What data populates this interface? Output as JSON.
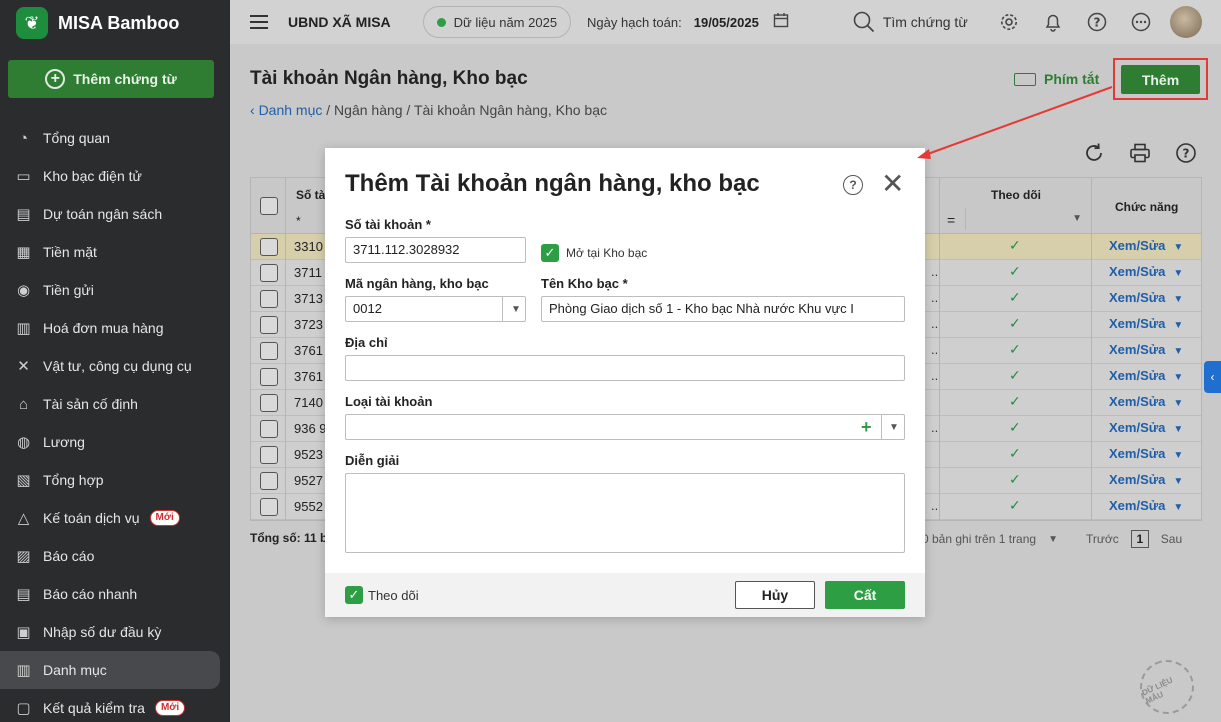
{
  "brand": {
    "name": "MISA Bamboo"
  },
  "new_voucher": {
    "label": "Thêm chứng từ"
  },
  "nav": [
    {
      "label": "Tổng quan",
      "icon": "pie-chart-icon"
    },
    {
      "label": "Kho bạc điện tử",
      "icon": "monitor-icon"
    },
    {
      "label": "Dự toán ngân sách",
      "icon": "budget-icon"
    },
    {
      "label": "Tiền mặt",
      "icon": "cash-icon"
    },
    {
      "label": "Tiền gửi",
      "icon": "deposit-icon"
    },
    {
      "label": "Hoá đơn mua hàng",
      "icon": "invoice-icon"
    },
    {
      "label": "Vật tư, công cụ dụng cụ",
      "icon": "tools-icon"
    },
    {
      "label": "Tài sản cố định",
      "icon": "building-icon"
    },
    {
      "label": "Lương",
      "icon": "salary-icon"
    },
    {
      "label": "Tổng hợp",
      "icon": "summary-icon"
    },
    {
      "label": "Kế toán dịch vụ",
      "icon": "service-icon",
      "badge": "Mới"
    },
    {
      "label": "Báo cáo",
      "icon": "report-icon"
    },
    {
      "label": "Báo cáo nhanh",
      "icon": "quick-report-icon"
    },
    {
      "label": "Nhập số dư đầu kỳ",
      "icon": "opening-balance-icon"
    },
    {
      "label": "Danh mục",
      "icon": "catalog-icon",
      "active": true
    },
    {
      "label": "Kết quả kiểm tra",
      "icon": "check-result-icon",
      "badge": "Mới"
    }
  ],
  "topbar": {
    "org": "UBND XÃ MISA",
    "data_year": "Dữ liệu năm 2025",
    "post_date_label": "Ngày hạch toán:",
    "post_date": "19/05/2025",
    "search": "Tìm chứng từ"
  },
  "page": {
    "title": "Tài khoản Ngân hàng, Kho bạc",
    "breadcrumb_link": "Danh mục",
    "breadcrumb_rest": " / Ngân hàng / Tài khoản Ngân hàng, Kho bạc",
    "shortcut": "Phím tắt",
    "add": "Thêm"
  },
  "table": {
    "col_account": "Số tà",
    "col_follow": "Theo dõi",
    "col_action": "Chức năng",
    "filter_star": "*",
    "filter_eq": "=",
    "rows": [
      {
        "no": "3310",
        "dots": "",
        "action": "Xem/Sửa",
        "selected": true
      },
      {
        "no": "3711",
        "dots": "..",
        "action": "Xem/Sửa"
      },
      {
        "no": "3713",
        "dots": "..",
        "action": "Xem/Sửa"
      },
      {
        "no": "3723",
        "dots": "..",
        "action": "Xem/Sửa"
      },
      {
        "no": "3761",
        "dots": "..",
        "action": "Xem/Sửa"
      },
      {
        "no": "3761",
        "dots": "..",
        "action": "Xem/Sửa"
      },
      {
        "no": "7140",
        "dots": "",
        "action": "Xem/Sửa"
      },
      {
        "no": "936 9",
        "dots": "..",
        "action": "Xem/Sửa"
      },
      {
        "no": "9523",
        "dots": "",
        "action": "Xem/Sửa"
      },
      {
        "no": "9527",
        "dots": "",
        "action": "Xem/Sửa"
      },
      {
        "no": "9552",
        "dots": "..",
        "action": "Xem/Sửa"
      }
    ],
    "total": "Tổng số: 11 b",
    "pager_info": "0 bản ghi trên 1 trang",
    "prev": "Trước",
    "page": "1",
    "next": "Sau"
  },
  "dialog": {
    "title": "Thêm Tài khoản ngân hàng, kho bạc",
    "account_no_label": "Số tài khoản *",
    "account_no": "3711.112.3028932",
    "open_at_treasury": "Mở tại Kho bạc",
    "bank_code_label": "Mã ngân hàng, kho bạc",
    "bank_code": "0012",
    "treasury_name_label": "Tên Kho bạc *",
    "treasury_name": "Phòng Giao dịch số 1 - Kho bạc Nhà nước Khu vực I",
    "address_label": "Địa chỉ",
    "address": "",
    "account_type_label": "Loại tài khoản",
    "account_type": "",
    "description_label": "Diễn giải",
    "description": "",
    "follow": "Theo dõi",
    "cancel": "Hủy",
    "save": "Cất"
  },
  "watermark": "DỮ LIỆU MẪU",
  "colors": {
    "brand_green": "#2e7d32",
    "check_green": "#2e9e45",
    "link_blue": "#1f5ea8",
    "highlight_red": "#e53935",
    "sidebar_bg": "#2b2c2e"
  }
}
